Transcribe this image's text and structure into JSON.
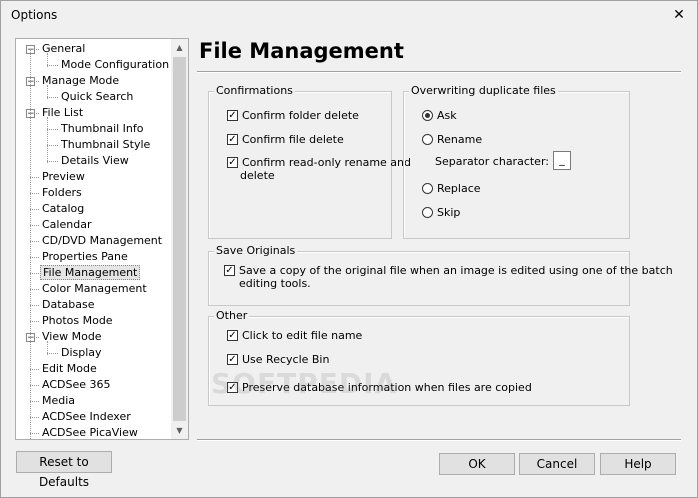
{
  "window": {
    "title": "Options",
    "close_glyph": "✕"
  },
  "tree": {
    "items": [
      {
        "label": "General",
        "level": 0,
        "expander": "−"
      },
      {
        "label": "Mode Configuration",
        "level": 1
      },
      {
        "label": "Manage Mode",
        "level": 0,
        "expander": "−"
      },
      {
        "label": "Quick Search",
        "level": 1
      },
      {
        "label": "File List",
        "level": 0,
        "expander": "−"
      },
      {
        "label": "Thumbnail Info",
        "level": 1
      },
      {
        "label": "Thumbnail Style",
        "level": 1
      },
      {
        "label": "Details View",
        "level": 1
      },
      {
        "label": "Preview",
        "level": 0
      },
      {
        "label": "Folders",
        "level": 0
      },
      {
        "label": "Catalog",
        "level": 0
      },
      {
        "label": "Calendar",
        "level": 0
      },
      {
        "label": "CD/DVD Management",
        "level": 0
      },
      {
        "label": "Properties Pane",
        "level": 0
      },
      {
        "label": "File Management",
        "level": 0,
        "selected": true
      },
      {
        "label": "Color Management",
        "level": 0
      },
      {
        "label": "Database",
        "level": 0
      },
      {
        "label": "Photos Mode",
        "level": 0
      },
      {
        "label": "View Mode",
        "level": 0,
        "expander": "−"
      },
      {
        "label": "Display",
        "level": 1
      },
      {
        "label": "Edit Mode",
        "level": 0
      },
      {
        "label": "ACDSee 365",
        "level": 0
      },
      {
        "label": "Media",
        "level": 0
      },
      {
        "label": "ACDSee Indexer",
        "level": 0
      },
      {
        "label": "ACDSee PicaView",
        "level": 0
      }
    ],
    "scroll_up": "▲",
    "scroll_down": "▼"
  },
  "page": {
    "heading": "File Management"
  },
  "confirmations": {
    "label": "Confirmations",
    "folder_delete": "Confirm folder delete",
    "file_delete": "Confirm file delete",
    "readonly_line1": "Confirm read-only rename and",
    "readonly_line2": "delete"
  },
  "overwriting": {
    "label": "Overwriting duplicate files",
    "ask": "Ask",
    "rename": "Rename",
    "separator_label": "Separator character:",
    "separator_value": "_",
    "replace": "Replace",
    "skip": "Skip",
    "selected": "ask"
  },
  "save_originals": {
    "label": "Save Originals",
    "line1": "Save a copy of the original file when an image is edited using one of the batch",
    "line2": "editing tools."
  },
  "other": {
    "label": "Other",
    "click_edit": "Click to edit file name",
    "recycle_bin": "Use Recycle Bin",
    "preserve_db": "Preserve database information when files are copied"
  },
  "checkmark": "✓",
  "buttons": {
    "reset": "Reset to Defaults",
    "ok": "OK",
    "cancel": "Cancel",
    "help": "Help"
  },
  "watermark": "SOFTPEDIA"
}
